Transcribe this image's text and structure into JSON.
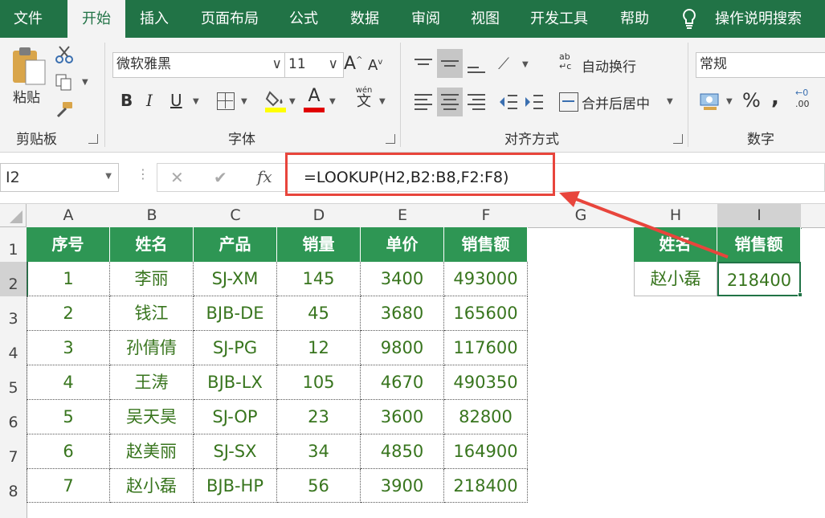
{
  "tabs": [
    "文件",
    "开始",
    "插入",
    "页面布局",
    "公式",
    "数据",
    "审阅",
    "视图",
    "开发工具",
    "帮助"
  ],
  "tell_me": "操作说明搜索",
  "ribbon": {
    "paste": "粘贴",
    "clipboard_label": "剪贴板",
    "font_name": "微软雅黑",
    "font_size": "11",
    "grow_font": "A",
    "shrink_font": "A",
    "bold": "B",
    "italic": "I",
    "underline": "U",
    "font_color_glyph": "A",
    "phonetic": "wén",
    "phonetic_char": "文",
    "font_label": "字体",
    "wrap_text": "自动换行",
    "merge_center": "合并后居中",
    "align_label": "对齐方式",
    "number_format": "常规",
    "percent": "%",
    "comma": ",",
    "decimal": ".00",
    "number_label": "数字",
    "highlight_color": "#ffff00",
    "font_color": "#e00000"
  },
  "formula_bar": {
    "name_box": "I2",
    "cancel": "✕",
    "enter": "✔",
    "fx": "fx",
    "formula": "=LOOKUP(H2,B2:B8,F2:F8)"
  },
  "columns": [
    "A",
    "B",
    "C",
    "D",
    "E",
    "F",
    "G",
    "H",
    "I"
  ],
  "rows": [
    "1",
    "2",
    "3",
    "4",
    "5",
    "6",
    "7",
    "8"
  ],
  "table": {
    "headers": [
      "序号",
      "姓名",
      "产品",
      "销量",
      "单价",
      "销售额"
    ],
    "data": [
      [
        "1",
        "李丽",
        "SJ-XM",
        "145",
        "3400",
        "493000"
      ],
      [
        "2",
        "钱江",
        "BJB-DE",
        "45",
        "3680",
        "165600"
      ],
      [
        "3",
        "孙倩倩",
        "SJ-PG",
        "12",
        "9800",
        "117600"
      ],
      [
        "4",
        "王涛",
        "BJB-LX",
        "105",
        "4670",
        "490350"
      ],
      [
        "5",
        "吴天昊",
        "SJ-OP",
        "23",
        "3600",
        "82800"
      ],
      [
        "6",
        "赵美丽",
        "SJ-SX",
        "34",
        "4850",
        "164900"
      ],
      [
        "7",
        "赵小磊",
        "BJB-HP",
        "56",
        "3900",
        "218400"
      ]
    ]
  },
  "lookup": {
    "headers": [
      "姓名",
      "销售额"
    ],
    "values": [
      "赵小磊",
      "218400"
    ]
  },
  "colors": {
    "ribbon_green": "#217346",
    "header_fill": "#2e9654",
    "cell_text": "#38751e",
    "annotation_red": "#e8453c"
  }
}
